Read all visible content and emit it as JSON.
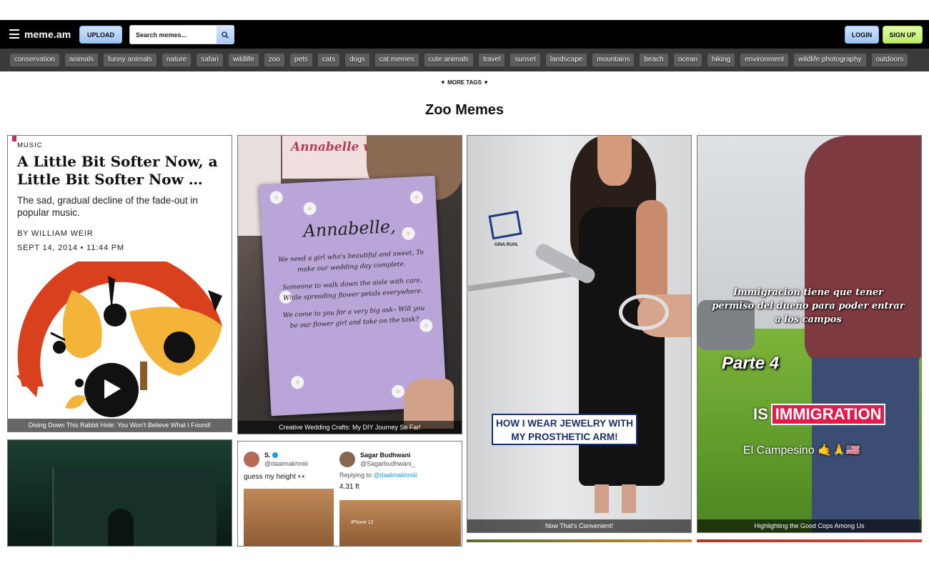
{
  "nav": {
    "logo": "meme.am",
    "upload_label": "UPLOAD",
    "search_placeholder": "Search memes...",
    "login_label": "LOGIN",
    "signup_label": "SIGN UP"
  },
  "tags": [
    "conservation",
    "animals",
    "funny animals",
    "nature",
    "safari",
    "wildlife",
    "zoo",
    "pets",
    "cats",
    "dogs",
    "cat memes",
    "cute animals",
    "travel",
    "sunset",
    "landscape",
    "mountains",
    "beach",
    "ocean",
    "hiking",
    "environment",
    "wildlife photography",
    "outdoors"
  ],
  "more_tags_label": "▼ MORE TAGS ▼",
  "page_title": "Zoo Memes",
  "cards": {
    "c1": {
      "caption": "Diving Down This Rabbit Hole: You Won't Believe What I Found!",
      "kicker": "MUSIC",
      "headline": "A Little Bit Softer Now, a Little Bit Softer Now …",
      "dek": "The sad, gradual decline of the fade-out in popular music.",
      "byline": "BY WILLIAM WEIR",
      "date": "SEPT 14, 2014 • 11:44 PM"
    },
    "c2": {
      "caption": "Creative Wedding Crafts: My DIY Journey So Far!",
      "sign": "Annabelle will you be",
      "name": "Annabelle,",
      "poem": [
        "We need a girl who's beautiful and sweet, To make our wedding day complete.",
        "Someone to walk down the aisle with care, While spreading flower petals everywhere.",
        "We come to you for a very big ask– Will you be our flower girl and take on the task?"
      ]
    },
    "c3": {
      "caption": "Now That's Convenient!",
      "overlay": "HOW I WEAR JEWELRY WITH MY PROSTHETIC ARM!",
      "logo_text": "GINA.RUHL"
    },
    "c4": {
      "caption": "Highlighting the Good Cops Among Us",
      "text1": "Immigracion tiene que tener permiso del dueño para poder entrar a los campos",
      "text2": "Parte 4",
      "is_label": "IS",
      "imm_label": "IMMIGRATION",
      "campesino": "El Campesino 🤙🙏🇺🇸"
    },
    "c6": {
      "user1": "S.",
      "handle1": "@daalmakhniiii",
      "tweet1": "guess my height 👀",
      "user2": "Sagar Budhwani",
      "handle2": "@Sagarbudhwani_",
      "replying": "Replying to",
      "replying_handle": "@daalmakhniiii",
      "tweet2": "4.31 ft",
      "iphone_label": "iPhone 12"
    }
  }
}
